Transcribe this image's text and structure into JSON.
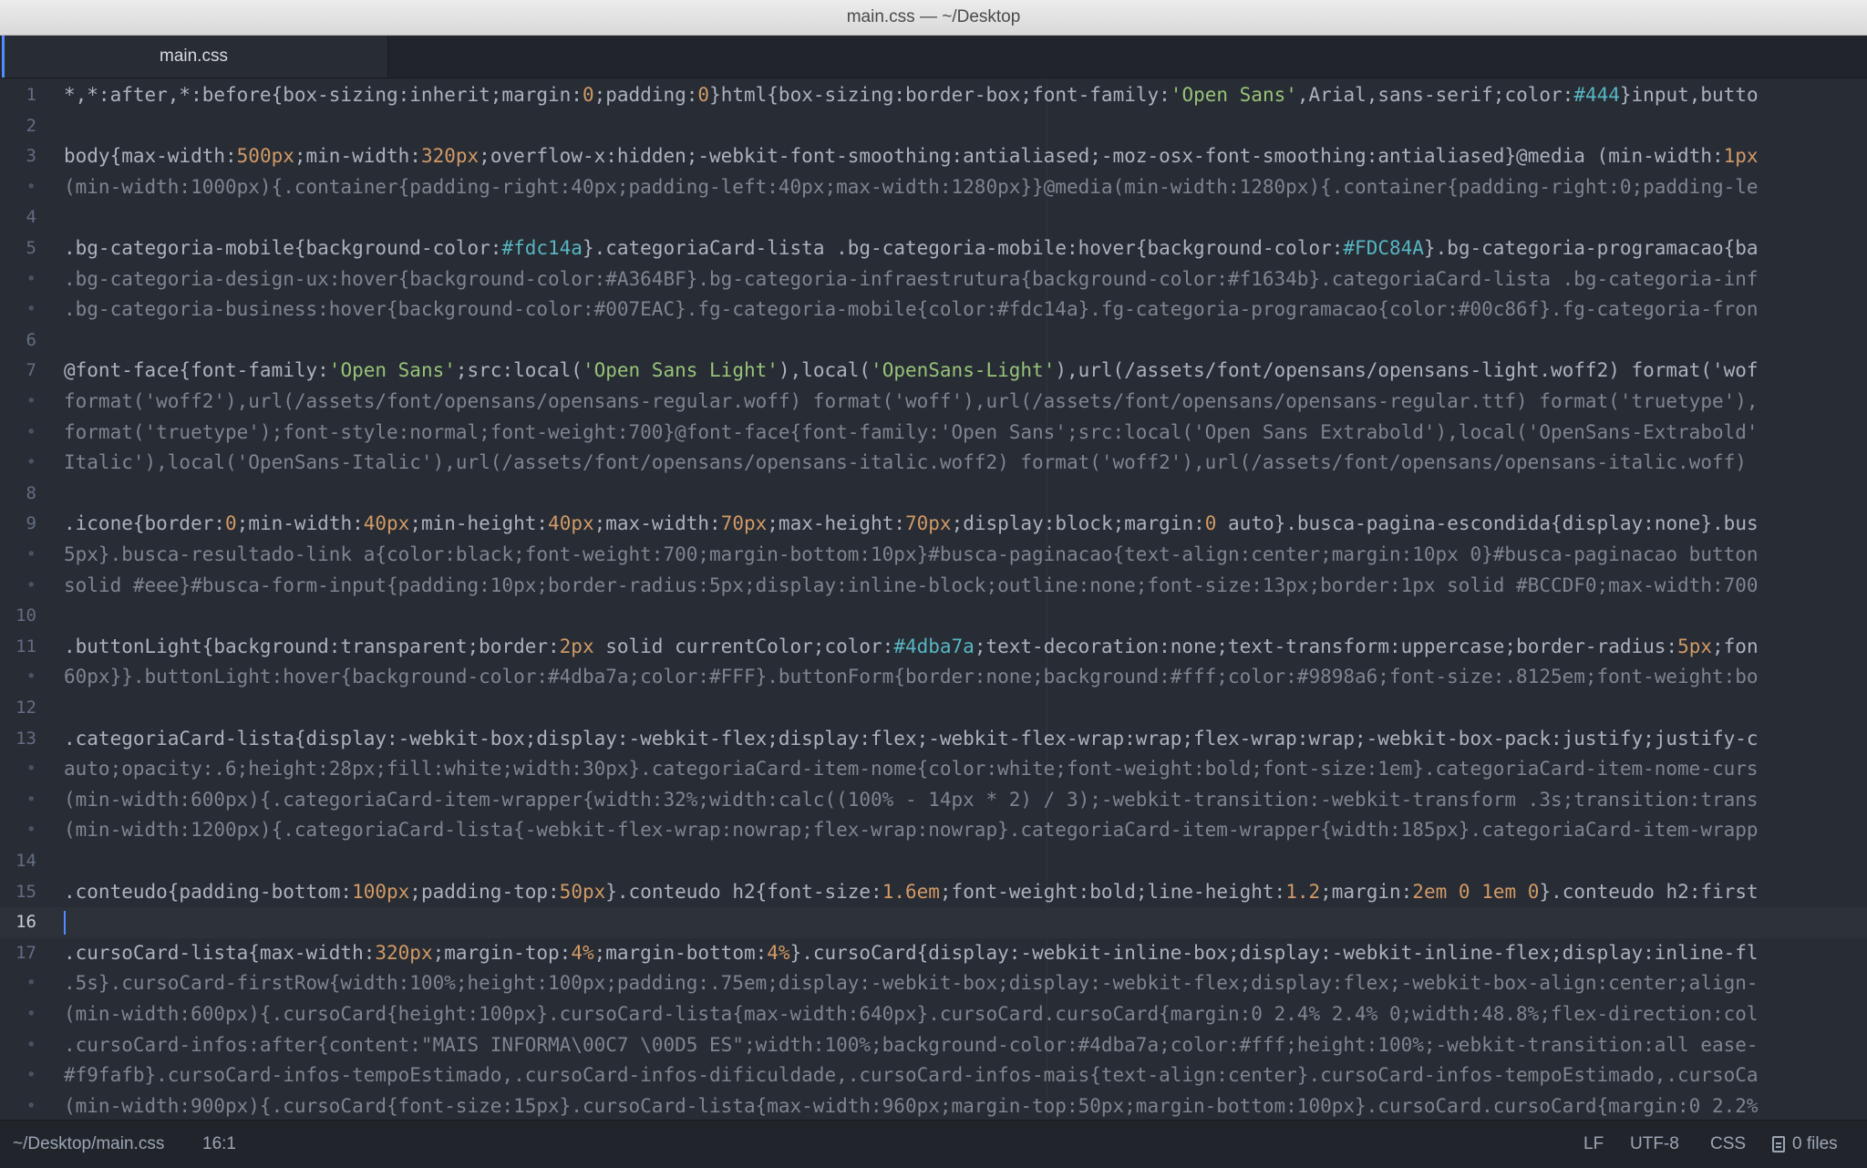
{
  "window": {
    "title": "main.css — ~/Desktop"
  },
  "tabs": [
    {
      "label": "main.css",
      "active": true
    }
  ],
  "editor": {
    "cursor_line": 16,
    "lines": [
      {
        "num": "1",
        "text": "*,*:after,*:before{box-sizing:inherit;margin:0;padding:0}html{box-sizing:border-box;font-family:'Open Sans',Arial,sans-serif;color:#444}input,butto"
      },
      {
        "num": "2",
        "text": ""
      },
      {
        "num": "3",
        "text": "body{max-width:500px;min-width:320px;overflow-x:hidden;-webkit-font-smoothing:antialiased;-moz-osx-font-smoothing:antialiased}@media (min-width:1px"
      },
      {
        "num": "•",
        "text": "(min-width:1000px){.container{padding-right:40px;padding-left:40px;max-width:1280px}}@media(min-width:1280px){.container{padding-right:0;padding-le"
      },
      {
        "num": "4",
        "text": ""
      },
      {
        "num": "5",
        "text": ".bg-categoria-mobile{background-color:#fdc14a}.categoriaCard-lista .bg-categoria-mobile:hover{background-color:#FDC84A}.bg-categoria-programacao{ba"
      },
      {
        "num": "•",
        "text": ".bg-categoria-design-ux:hover{background-color:#A364BF}.bg-categoria-infraestrutura{background-color:#f1634b}.categoriaCard-lista .bg-categoria-inf"
      },
      {
        "num": "•",
        "text": ".bg-categoria-business:hover{background-color:#007EAC}.fg-categoria-mobile{color:#fdc14a}.fg-categoria-programacao{color:#00c86f}.fg-categoria-fron"
      },
      {
        "num": "6",
        "text": ""
      },
      {
        "num": "7",
        "text": "@font-face{font-family:'Open Sans';src:local('Open Sans Light'),local('OpenSans-Light'),url(/assets/font/opensans/opensans-light.woff2) format('wof"
      },
      {
        "num": "•",
        "text": "format('woff2'),url(/assets/font/opensans/opensans-regular.woff) format('woff'),url(/assets/font/opensans/opensans-regular.ttf) format('truetype'),"
      },
      {
        "num": "•",
        "text": "format('truetype');font-style:normal;font-weight:700}@font-face{font-family:'Open Sans';src:local('Open Sans Extrabold'),local('OpenSans-Extrabold'"
      },
      {
        "num": "•",
        "text": "Italic'),local('OpenSans-Italic'),url(/assets/font/opensans/opensans-italic.woff2) format('woff2'),url(/assets/font/opensans/opensans-italic.woff)"
      },
      {
        "num": "8",
        "text": ""
      },
      {
        "num": "9",
        "text": ".icone{border:0;min-width:40px;min-height:40px;max-width:70px;max-height:70px;display:block;margin:0 auto}.busca-pagina-escondida{display:none}.bus"
      },
      {
        "num": "•",
        "text": "5px}.busca-resultado-link a{color:black;font-weight:700;margin-bottom:10px}#busca-paginacao{text-align:center;margin:10px 0}#busca-paginacao button"
      },
      {
        "num": "•",
        "text": "solid #eee}#busca-form-input{padding:10px;border-radius:5px;display:inline-block;outline:none;font-size:13px;border:1px solid #BCCDF0;max-width:700"
      },
      {
        "num": "10",
        "text": ""
      },
      {
        "num": "11",
        "text": ".buttonLight{background:transparent;border:2px solid currentColor;color:#4dba7a;text-decoration:none;text-transform:uppercase;border-radius:5px;fon"
      },
      {
        "num": "•",
        "text": "60px}}.buttonLight:hover{background-color:#4dba7a;color:#FFF}.buttonForm{border:none;background:#fff;color:#9898a6;font-size:.8125em;font-weight:bo"
      },
      {
        "num": "12",
        "text": ""
      },
      {
        "num": "13",
        "text": ".categoriaCard-lista{display:-webkit-box;display:-webkit-flex;display:flex;-webkit-flex-wrap:wrap;flex-wrap:wrap;-webkit-box-pack:justify;justify-c"
      },
      {
        "num": "•",
        "text": "auto;opacity:.6;height:28px;fill:white;width:30px}.categoriaCard-item-nome{color:white;font-weight:bold;font-size:1em}.categoriaCard-item-nome-curs"
      },
      {
        "num": "•",
        "text": "(min-width:600px){.categoriaCard-item-wrapper{width:32%;width:calc((100% - 14px * 2) / 3);-webkit-transition:-webkit-transform .3s;transition:trans"
      },
      {
        "num": "•",
        "text": "(min-width:1200px){.categoriaCard-lista{-webkit-flex-wrap:nowrap;flex-wrap:nowrap}.categoriaCard-item-wrapper{width:185px}.categoriaCard-item-wrapp"
      },
      {
        "num": "14",
        "text": ""
      },
      {
        "num": "15",
        "text": ".conteudo{padding-bottom:100px;padding-top:50px}.conteudo h2{font-size:1.6em;font-weight:bold;line-height:1.2;margin:2em 0 1em 0}.conteudo h2:first"
      },
      {
        "num": "16",
        "text": ""
      },
      {
        "num": "17",
        "text": ".cursoCard-lista{max-width:320px;margin-top:4%;margin-bottom:4%}.cursoCard{display:-webkit-inline-box;display:-webkit-inline-flex;display:inline-fl"
      },
      {
        "num": "•",
        "text": ".5s}.cursoCard-firstRow{width:100%;height:100px;padding:.75em;display:-webkit-box;display:-webkit-flex;display:flex;-webkit-box-align:center;align-"
      },
      {
        "num": "•",
        "text": "(min-width:600px){.cursoCard{height:100px}.cursoCard-lista{max-width:640px}.cursoCard.cursoCard{margin:0 2.4% 2.4% 0;width:48.8%;flex-direction:col"
      },
      {
        "num": "•",
        "text": ".cursoCard-infos:after{content:\"MAIS INFORMA\\00C7 \\00D5 ES\";width:100%;background-color:#4dba7a;color:#fff;height:100%;-webkit-transition:all ease-"
      },
      {
        "num": "•",
        "text": "#f9fafb}.cursoCard-infos-tempoEstimado,.cursoCard-infos-dificuldade,.cursoCard-infos-mais{text-align:center}.cursoCard-infos-tempoEstimado,.cursoCa"
      },
      {
        "num": "•",
        "text": "(min-width:900px){.cursoCard{font-size:15px}.cursoCard-lista{max-width:960px;margin-top:50px;margin-bottom:100px}.cursoCard.cursoCard{margin:0 2.2%"
      }
    ]
  },
  "statusbar": {
    "file_path": "~/Desktop/main.css",
    "cursor_position": "16:1",
    "line_ending": "LF",
    "encoding": "UTF-8",
    "grammar": "CSS",
    "git_files": "0 files"
  },
  "colors": {
    "background": "#282c34",
    "accent": "#528bff",
    "selector": "#e06c75",
    "number": "#d19a66",
    "string": "#98c379"
  }
}
